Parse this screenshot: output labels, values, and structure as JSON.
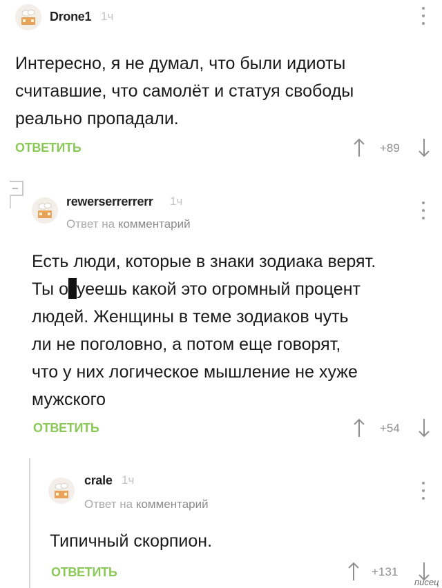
{
  "comments": [
    {
      "username": "Drone1",
      "time": "1ч",
      "body_lines": [
        "Интересно, я не думал, что были идиоты",
        "считавшие, что самолёт и статуя свободы",
        "реально пропадали."
      ],
      "reply_label": "ОТВЕТИТЬ",
      "score": "+89"
    },
    {
      "username": "rewerserrerrerr",
      "time": "1ч",
      "reply_to_prefix": "Ответ на",
      "reply_to_target": "комментарий",
      "body_lines": [
        "Есть люди, которые в знаки зодиака верят.",
        "Ты о",
        "уеешь какой это огромный процент",
        "людей. Женщины в теме зодиаков чуть",
        "ли не поголовно, а потом еще говорят,",
        "что у них логическое мышление не хуже",
        "мужского"
      ],
      "reply_label": "ОТВЕТИТЬ",
      "score": "+54"
    },
    {
      "username": "crale",
      "time": "1ч",
      "reply_to_prefix": "Ответ на",
      "reply_to_target": "комментарий",
      "body_lines": [
        "Типичный скорпион."
      ],
      "reply_label": "ОТВЕТИТЬ",
      "score": "+131"
    }
  ],
  "watermark": "писец",
  "colors": {
    "accent_green": "#8ac858",
    "muted": "#a9a9a9",
    "thread_line": "#d6d6d6"
  },
  "icons": {
    "avatar": "default-avatar-icon",
    "menu": "kebab-menu-icon",
    "upvote": "arrow-up-icon",
    "downvote": "arrow-down-icon",
    "collapse": "collapse-thread-icon"
  }
}
